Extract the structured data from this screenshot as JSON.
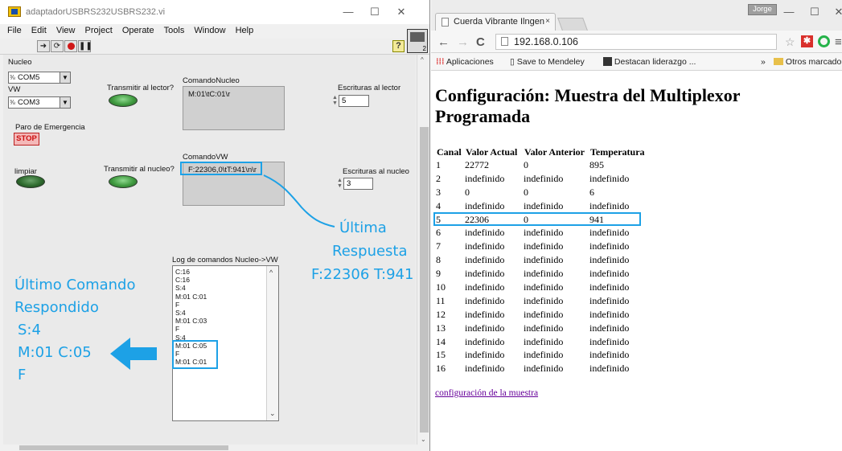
{
  "labview": {
    "title": "adaptadorUSBRS232USBRS232.vi",
    "window_buttons": [
      "—",
      "☐",
      "✕"
    ],
    "menu": [
      "File",
      "Edit",
      "View",
      "Project",
      "Operate",
      "Tools",
      "Window",
      "Help"
    ],
    "help_glyph": "?",
    "vi_icon_label": "2",
    "nucleo": {
      "label": "Nucleo",
      "value": "COM5"
    },
    "vw": {
      "label": "VW",
      "value": "COM3"
    },
    "transmitir_lector": "Transmitir al lector?",
    "comando_nucleo": {
      "label": "ComandoNucleo",
      "value": "M:01\\tC:01\\r"
    },
    "escrituras_lector": {
      "label": "Escrituras al lector",
      "value": "5"
    },
    "paro": {
      "label": "Paro de Emergencia",
      "button": "STOP"
    },
    "limpiar": "limpiar",
    "transmitir_nucleo": "Transmitir al nucleo?",
    "comando_vw": {
      "label": "ComandoVW",
      "value": "F:22306,0\\tT:941\\n\\r"
    },
    "escrituras_nucleo": {
      "label": "Escrituras al nucleo",
      "value": "3"
    },
    "log": {
      "label": "Log de comandos Nucleo->VW",
      "items": [
        "C:16",
        "C:16",
        "S:4",
        "M:01 C:01",
        "F",
        "S:4",
        "M:01 C:03",
        "F",
        "S:4",
        "M:01 C:05",
        "F",
        "M:01 C:01"
      ]
    }
  },
  "annotations": {
    "ultima_1": "Última",
    "ultima_2": "Respuesta",
    "ultima_3": "F:22306 T:941",
    "ultimo_1": "Último Comando",
    "ultimo_2": "Respondido",
    "ultimo_3": "S:4",
    "ultimo_4": "M:01 C:05",
    "ultimo_5": "F",
    "accent": "#1da1e6"
  },
  "chrome": {
    "tab_title": "Cuerda Vibrante Ilngen",
    "tab_close": "×",
    "user": "Jorge",
    "window_buttons": [
      "—",
      "☐",
      "✕"
    ],
    "url": "192.168.0.106",
    "bookmarks": {
      "apps": "Aplicaciones",
      "mendeley": "Save to Mendeley",
      "destacan": "Destacan liderazgo ...",
      "more": "»",
      "otros": "Otros marcadores"
    },
    "heading": "Configuración: Muestra del Multiplexor Programada",
    "table": {
      "headers": [
        "Canal",
        "Valor Actual",
        "Valor Anterior",
        "Temperatura"
      ],
      "rows": [
        [
          "1",
          "22772",
          "0",
          "895"
        ],
        [
          "2",
          "indefinido",
          "indefinido",
          "indefinido"
        ],
        [
          "3",
          "0",
          "0",
          "6"
        ],
        [
          "4",
          "indefinido",
          "indefinido",
          "indefinido"
        ],
        [
          "5",
          "22306",
          "0",
          "941"
        ],
        [
          "6",
          "indefinido",
          "indefinido",
          "indefinido"
        ],
        [
          "7",
          "indefinido",
          "indefinido",
          "indefinido"
        ],
        [
          "8",
          "indefinido",
          "indefinido",
          "indefinido"
        ],
        [
          "9",
          "indefinido",
          "indefinido",
          "indefinido"
        ],
        [
          "10",
          "indefinido",
          "indefinido",
          "indefinido"
        ],
        [
          "11",
          "indefinido",
          "indefinido",
          "indefinido"
        ],
        [
          "12",
          "indefinido",
          "indefinido",
          "indefinido"
        ],
        [
          "13",
          "indefinido",
          "indefinido",
          "indefinido"
        ],
        [
          "14",
          "indefinido",
          "indefinido",
          "indefinido"
        ],
        [
          "15",
          "indefinido",
          "indefinido",
          "indefinido"
        ],
        [
          "16",
          "indefinido",
          "indefinido",
          "indefinido"
        ]
      ]
    },
    "link": "configuración de la muestra"
  }
}
